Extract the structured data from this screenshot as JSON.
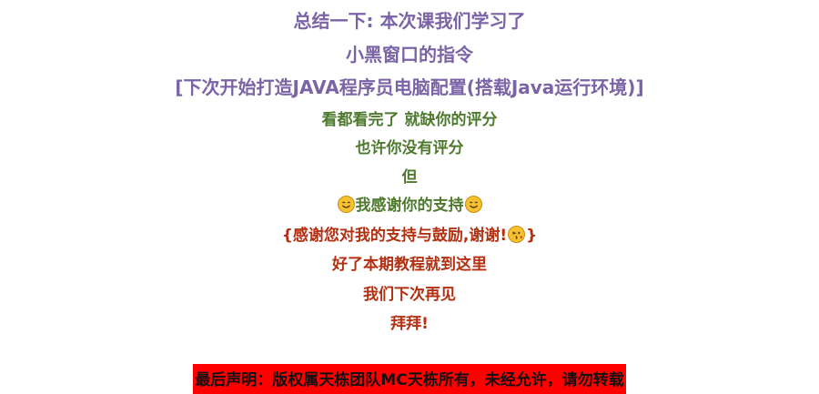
{
  "lines": {
    "l1": "总结一下: 本次课我们学习了",
    "l2": "小黑窗口的指令",
    "l3": "[下次开始打造JAVA程序员电脑配置(搭载Java运行环境)]",
    "l4": "看都看完了 就缺你的评分",
    "l5": "也许你没有评分",
    "l6": "但",
    "l7": "我感谢你的支持",
    "l8a": "{感谢您对我的支持与鼓励,谢谢!",
    "l8b": "}",
    "l9": "好了本期教程就到这里",
    "l10": "我们下次再见",
    "l11": "拜拜!"
  },
  "notice": "最后声明：版权属天栋团队MC天栋所有，未经允许，请勿转载",
  "icons": [
    "smiling-face-emoji",
    "smiling-face-emoji",
    "winking-kiss-emoji"
  ],
  "colors": {
    "purple": "#7b64a6",
    "green": "#4e7a2e",
    "red": "#b33012",
    "notice_bg": "#ff0000"
  }
}
